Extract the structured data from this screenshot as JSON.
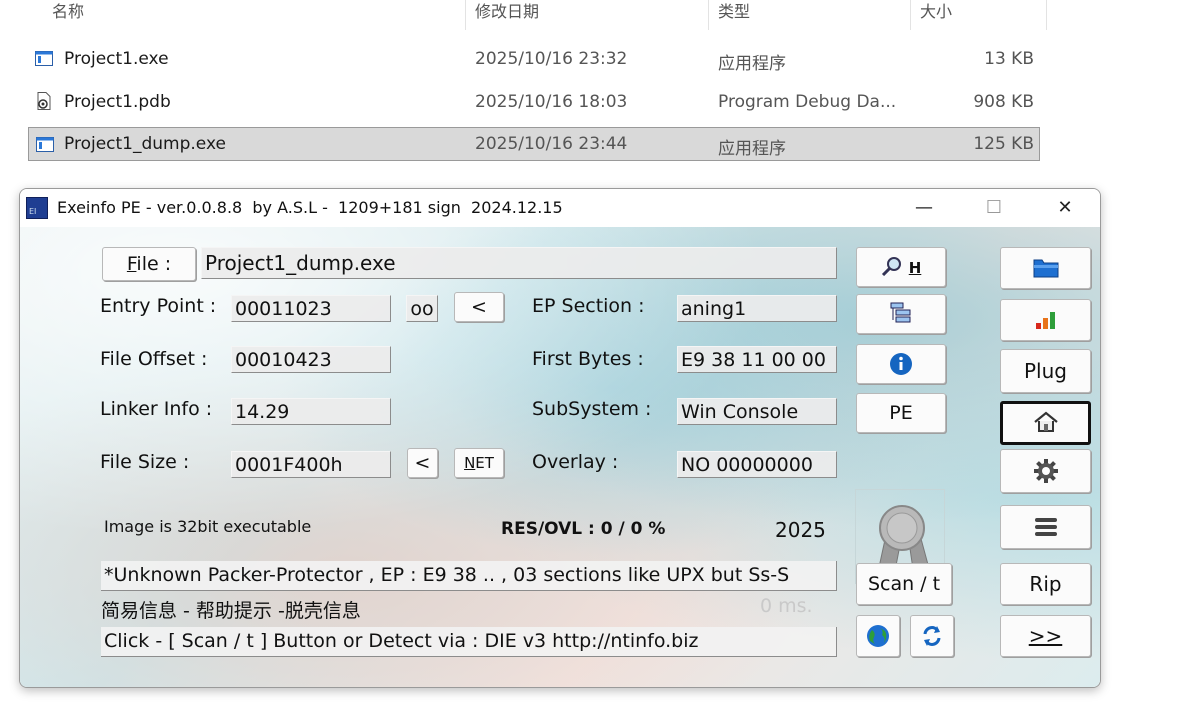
{
  "explorer": {
    "columns": {
      "name": "名称",
      "modified": "修改日期",
      "type": "类型",
      "size": "大小"
    },
    "files": [
      {
        "name": "Project1.exe",
        "modified": "2025/10/16 23:32",
        "type": "应用程序",
        "size": "13 KB",
        "icon": "exe-icon",
        "selected": false
      },
      {
        "name": "Project1.pdb",
        "modified": "2025/10/16 18:03",
        "type": "Program Debug Da...",
        "size": "908 KB",
        "icon": "pdb-file-icon",
        "selected": false
      },
      {
        "name": "Project1_dump.exe",
        "modified": "2025/10/16 23:44",
        "type": "应用程序",
        "size": "125 KB",
        "icon": "exe-icon",
        "selected": true
      }
    ]
  },
  "exeinfo": {
    "title": "Exeinfo PE - ver.0.0.8.8  by A.S.L -  1209+181 sign  2024.12.15",
    "window_controls": {
      "minimize": "—",
      "maximize": "☐",
      "close": "✕"
    },
    "file_button": {
      "first": "F",
      "rest": "ile :"
    },
    "file_name": "Project1_dump.exe",
    "entry_point_label": "Entry Point :",
    "entry_point": "00011023",
    "oo_button": "oo",
    "ep_prev_button": "<",
    "ep_section_label": "EP Section :",
    "ep_section": "aning1",
    "file_offset_label": "File Offset :",
    "file_offset": "00010423",
    "first_bytes_label": "First Bytes :",
    "first_bytes": "E9 38 11 00 00",
    "linker_info_label": "Linker Info :",
    "linker_info": "14.29",
    "subsystem_label": "SubSystem :",
    "subsystem": "Win Console",
    "file_size_label": "File Size :",
    "file_size": "0001F400h",
    "size_prev_button": "<",
    "net_button": {
      "first": "N",
      "rest": "ET"
    },
    "overlay_label": "Overlay :",
    "overlay": "NO   00000000",
    "image_info": "Image is 32bit executable",
    "res_ovl": "RES/OVL : 0 / 0 %",
    "year": "2025",
    "detection": "*Unknown Packer-Protector , EP : E9 38 .. , 03 sections  like UPX  but Ss-S",
    "hint": "简易信息 - 帮助提示 -脱壳信息",
    "timing": "0 ms.",
    "help": "Click - [ Scan / t ]  Button  or Detect via : DIE v3   http://ntinfo.biz",
    "side_buttons": {
      "search_h": "H",
      "pe": "PE",
      "scan": "Scan / t",
      "plug": "Plug",
      "rip": "Rip",
      "next": ">>"
    },
    "colors": {
      "info_blue": "#1565c0",
      "folder_blue": "#1e6fd0",
      "accent_orange": "#e8731a",
      "accent_green": "#2e9e3a"
    }
  }
}
